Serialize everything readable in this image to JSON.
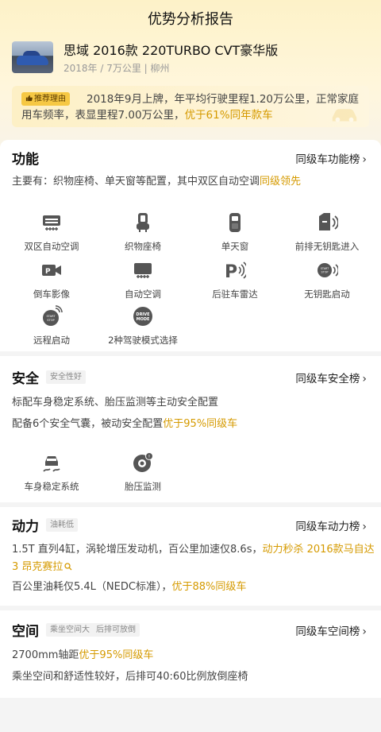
{
  "nav": {
    "title": "优势分析报告"
  },
  "car": {
    "name": "思域 2016款 220TURBO CVT豪华版",
    "meta": "2018年 / 7万公里 | 柳州"
  },
  "reason": {
    "badge": "推荐理由",
    "text_a": "2018年9月上牌，年平均行驶里程1.20万公里，正常家庭用车频率，表显里程7.00万公里，",
    "text_hl": "优于61%同年款车"
  },
  "function": {
    "title": "功能",
    "rank": "同级车功能榜",
    "summary_a": "主要有：织物座椅、单天窗等配置，其中双区自动空调",
    "summary_hl": "同级领先",
    "features": [
      {
        "label": "双区自动空调",
        "icon": "dual-zone-ac-icon"
      },
      {
        "label": "织物座椅",
        "icon": "fabric-seat-icon"
      },
      {
        "label": "单天窗",
        "icon": "sunroof-icon"
      },
      {
        "label": "前排无钥匙进入",
        "icon": "keyless-entry-icon"
      },
      {
        "label": "倒车影像",
        "icon": "reverse-camera-icon"
      },
      {
        "label": "自动空调",
        "icon": "auto-ac-icon"
      },
      {
        "label": "后驻车雷达",
        "icon": "parking-radar-icon"
      },
      {
        "label": "无钥匙启动",
        "icon": "keyless-start-icon"
      },
      {
        "label": "远程启动",
        "icon": "remote-start-icon"
      },
      {
        "label": "2种驾驶模式选择",
        "icon": "drive-mode-icon"
      }
    ],
    "icon_text": {
      "start": "START",
      "stop": "STOP",
      "drive": "DRIVE",
      "mode": "MODE"
    }
  },
  "safety": {
    "title": "安全",
    "tag": "安全性好",
    "rank": "同级车安全榜",
    "line1": "标配车身稳定系统、胎压监测等主动安全配置",
    "line2_a": "配备6个安全气囊，被动安全配置",
    "line2_hl": "优于95%同级车",
    "features": [
      {
        "label": "车身稳定系统",
        "icon": "stability-control-icon"
      },
      {
        "label": "胎压监测",
        "icon": "tire-pressure-icon"
      }
    ]
  },
  "power": {
    "title": "动力",
    "tag": "油耗低",
    "rank": "同级车动力榜",
    "line1_a": "1.5T 直列4缸，涡轮增压发动机，百公里加速仅8.6s，",
    "line1_hl": "动力秒杀 2016款马自达3 昂克赛拉",
    "line2_a": "百公里油耗仅5.4L（NEDC标准），",
    "line2_hl": "优于88%同级车"
  },
  "space": {
    "title": "空间",
    "tags": [
      "乘坐空间大",
      "后排可放倒"
    ],
    "rank": "同级车空间榜",
    "line1_a": "2700mm轴距",
    "line1_hl": "优于95%同级车",
    "line2": "乘坐空间和舒适性较好，后排可40:60比例放倒座椅"
  },
  "colors": {
    "accent": "#d59a00",
    "badge": "#f6c844"
  }
}
